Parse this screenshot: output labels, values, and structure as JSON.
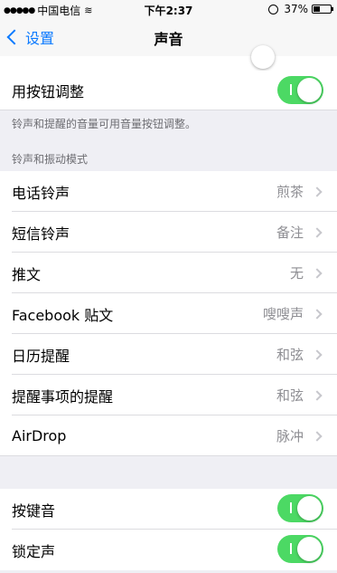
{
  "status_bar": {
    "signal": "●●●●●",
    "carrier": "中国电信",
    "wifi": "≋",
    "time": "下午2:37",
    "battery": "37%",
    "battery_level": 0.37
  },
  "nav": {
    "back_label": "设置",
    "title": "声音"
  },
  "toggle_row": {
    "label": "用按钮调整",
    "on": true
  },
  "footnote": "铃声和提醒的音量可用音量按钮调整。",
  "section_header": "铃声和振动模式",
  "sound_rows": [
    {
      "label": "电话铃声",
      "value": "煎茶"
    },
    {
      "label": "短信铃声",
      "value": "备注"
    },
    {
      "label": "推文",
      "value": "无"
    },
    {
      "label": "Facebook 贴文",
      "value": "嗖嗖声"
    },
    {
      "label": "日历提醒",
      "value": "和弦"
    },
    {
      "label": "提醒事项的提醒",
      "value": "和弦"
    },
    {
      "label": "AirDrop",
      "value": "脉冲"
    }
  ],
  "bottom_toggles": [
    {
      "label": "按键音",
      "on": true
    },
    {
      "label": "锁定声",
      "on": true
    }
  ],
  "colors": {
    "accent": "#0a7aff",
    "toggle_on": "#4cd964",
    "background": "#efeff4"
  }
}
